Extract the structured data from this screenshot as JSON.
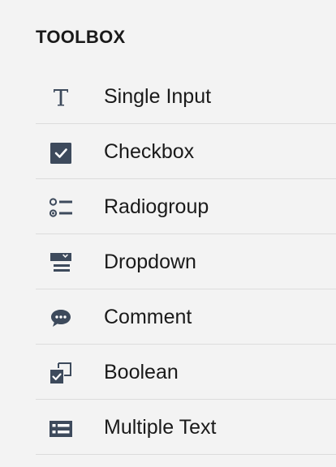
{
  "toolbox": {
    "title": "TOOLBOX",
    "icon_color": "#3d4a5c",
    "items": [
      {
        "label": "Single Input",
        "icon": "text-t-icon"
      },
      {
        "label": "Checkbox",
        "icon": "checkbox-icon"
      },
      {
        "label": "Radiogroup",
        "icon": "radiogroup-icon"
      },
      {
        "label": "Dropdown",
        "icon": "dropdown-icon"
      },
      {
        "label": "Comment",
        "icon": "comment-bubble-icon"
      },
      {
        "label": "Boolean",
        "icon": "boolean-icon"
      },
      {
        "label": "Multiple Text",
        "icon": "multiple-text-icon"
      }
    ]
  }
}
